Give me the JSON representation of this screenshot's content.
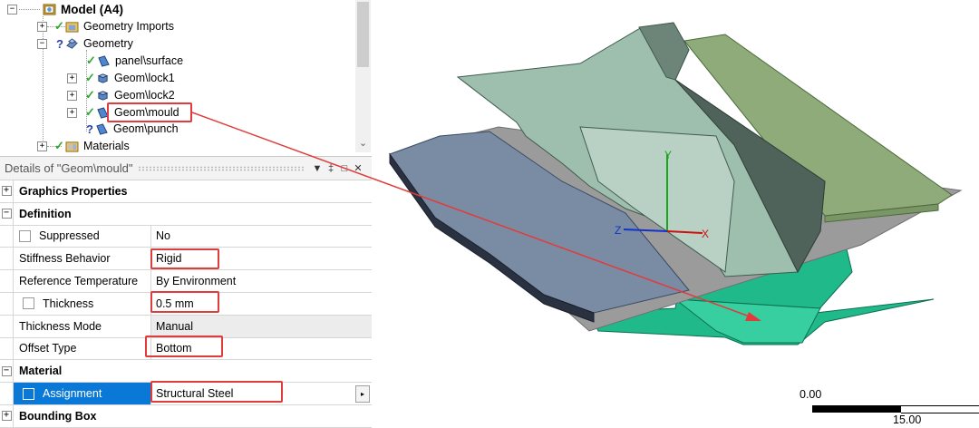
{
  "tree": {
    "items": [
      {
        "label": "Model (A4)"
      },
      {
        "label": "Geometry Imports"
      },
      {
        "label": "Geometry"
      },
      {
        "label": "panel\\surface"
      },
      {
        "label": "Geom\\lock1"
      },
      {
        "label": "Geom\\lock2"
      },
      {
        "label": "Geom\\mould"
      },
      {
        "label": "Geom\\punch"
      },
      {
        "label": "Materials"
      }
    ]
  },
  "details": {
    "title": "Details of \"Geom\\mould\"",
    "header_buttons": [
      "▼",
      "‡",
      "□",
      "✕"
    ],
    "categories": {
      "graphics": "Graphics Properties",
      "definition": "Definition",
      "material": "Material",
      "bounding": "Bounding Box"
    },
    "rows": {
      "suppressed": {
        "name": "Suppressed",
        "value": "No"
      },
      "stiffness": {
        "name": "Stiffness Behavior",
        "value": "Rigid"
      },
      "reftemp": {
        "name": "Reference Temperature",
        "value": "By Environment"
      },
      "thickness": {
        "name": "Thickness",
        "value": "0.5 mm"
      },
      "thickmode": {
        "name": "Thickness Mode",
        "value": "Manual"
      },
      "offset": {
        "name": "Offset Type",
        "value": "Bottom"
      },
      "assignment": {
        "name": "Assignment",
        "value": "Structural Steel"
      }
    }
  },
  "viewport": {
    "axes": {
      "x": "X",
      "y": "Y",
      "z": "Z"
    },
    "scale": {
      "start": "0.00",
      "end": "15.00"
    }
  },
  "colors": {
    "highlight": "#e03c3c",
    "selection": "#0a78d7",
    "check": "#2fa82f",
    "mould_green": "#1fb98a",
    "punch": "#9fbfae",
    "lock_blue": "#7a8ca3",
    "lock_green": "#8fab7a",
    "panel_gray": "#9b9b9b"
  },
  "icons": [
    "expand-icon",
    "model-icon",
    "check-icon",
    "question-icon",
    "geometry-icon",
    "surface-body-icon",
    "solid-body-icon",
    "materials-icon",
    "pin-icon",
    "close-icon",
    "dropdown-arrow-icon"
  ]
}
